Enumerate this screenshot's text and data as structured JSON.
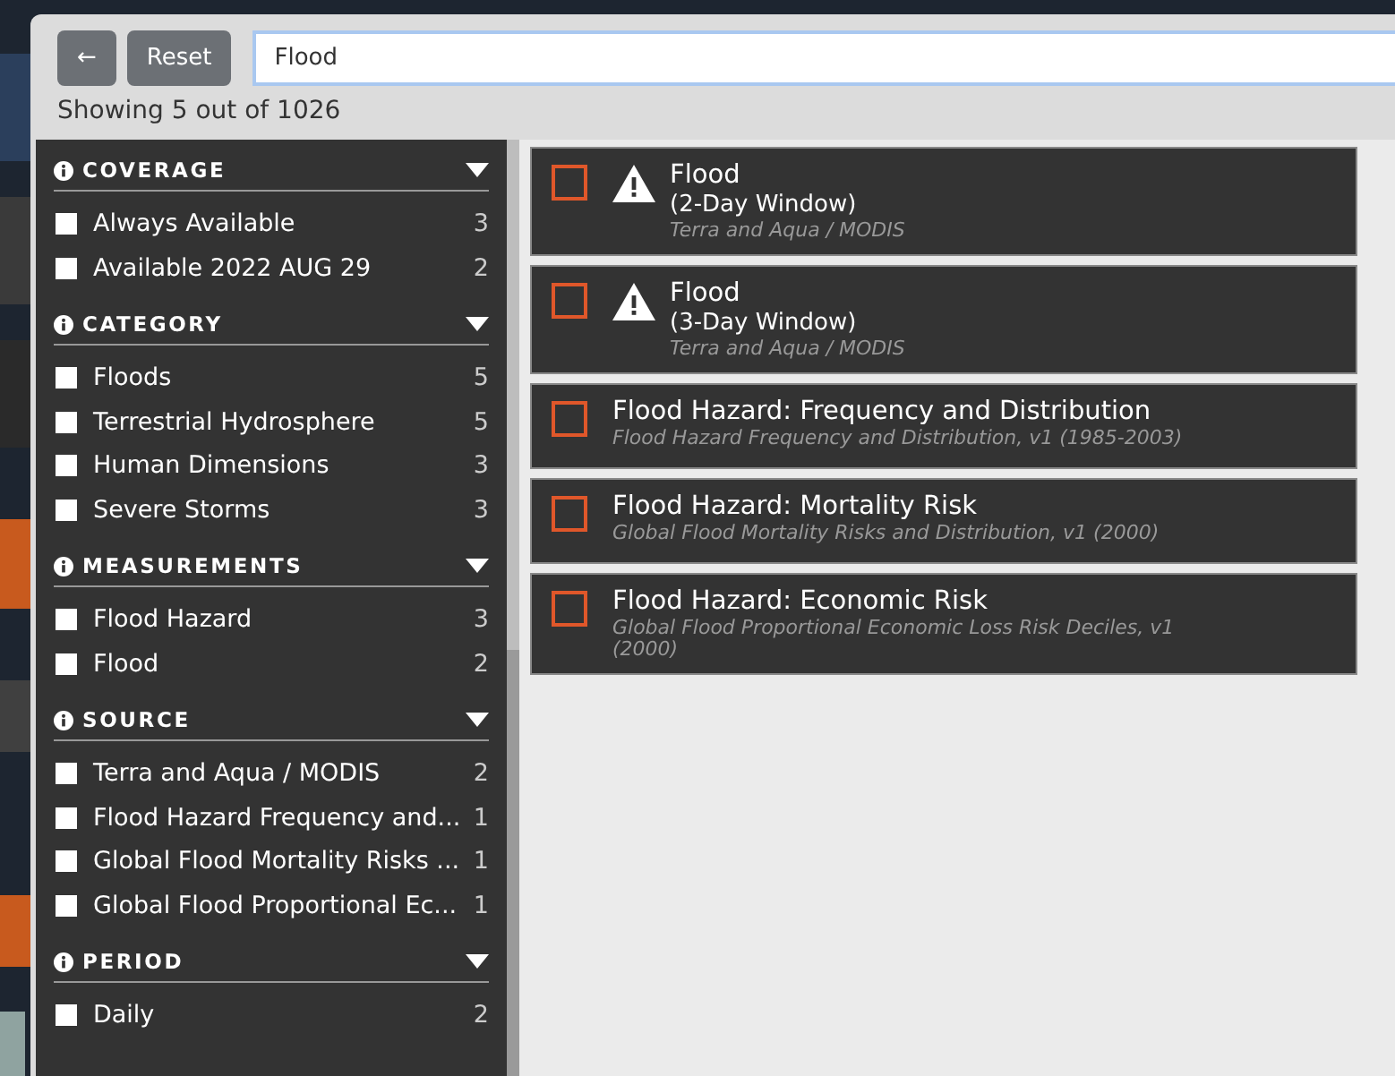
{
  "search": {
    "value": "Flood"
  },
  "buttons": {
    "back": "←",
    "reset": "Reset"
  },
  "summary": "Showing 5 out of 1026",
  "facets": [
    {
      "title": "COVERAGE",
      "expanded": true,
      "options": [
        {
          "label": "Always Available",
          "count": "3",
          "checked": false
        },
        {
          "label": "Available 2022 AUG 29",
          "count": "2",
          "checked": false
        }
      ]
    },
    {
      "title": "CATEGORY",
      "expanded": true,
      "options": [
        {
          "label": "Floods",
          "count": "5",
          "checked": false
        },
        {
          "label": "Terrestrial Hydrosphere",
          "count": "5",
          "checked": false
        },
        {
          "label": "Human Dimensions",
          "count": "3",
          "checked": false
        },
        {
          "label": "Severe Storms",
          "count": "3",
          "checked": false
        }
      ]
    },
    {
      "title": "MEASUREMENTS",
      "expanded": true,
      "options": [
        {
          "label": "Flood Hazard",
          "count": "3",
          "checked": false
        },
        {
          "label": "Flood",
          "count": "2",
          "checked": false
        }
      ]
    },
    {
      "title": "SOURCE",
      "expanded": true,
      "options": [
        {
          "label": "Terra and Aqua / MODIS",
          "count": "2",
          "checked": false
        },
        {
          "label": "Flood Hazard Frequency and...",
          "count": "1",
          "checked": false
        },
        {
          "label": "Global Flood Mortality Risks ...",
          "count": "1",
          "checked": false
        },
        {
          "label": "Global Flood Proportional Ec...",
          "count": "1",
          "checked": false
        }
      ]
    },
    {
      "title": "PERIOD",
      "expanded": true,
      "options": [
        {
          "label": "Daily",
          "count": "2",
          "checked": false
        }
      ]
    }
  ],
  "results": [
    {
      "title": "Flood",
      "subtitle": "(2-Day Window)",
      "source": "Terra and Aqua / MODIS",
      "warning": true,
      "checked": false
    },
    {
      "title": "Flood",
      "subtitle": "(3-Day Window)",
      "source": "Terra and Aqua / MODIS",
      "warning": true,
      "checked": false
    },
    {
      "title": "Flood Hazard: Frequency and Distribution",
      "source": "Flood Hazard Frequency and Distribution, v1 (1985-2003)",
      "warning": false,
      "checked": false
    },
    {
      "title": "Flood Hazard: Mortality Risk",
      "source": "Global Flood Mortality Risks and Distribution, v1 (2000)",
      "warning": false,
      "checked": false
    },
    {
      "title": "Flood Hazard: Economic Risk",
      "source": "Global Flood Proportional Economic Loss Risk Deciles, v1 (2000)",
      "warning": false,
      "checked": false
    }
  ]
}
